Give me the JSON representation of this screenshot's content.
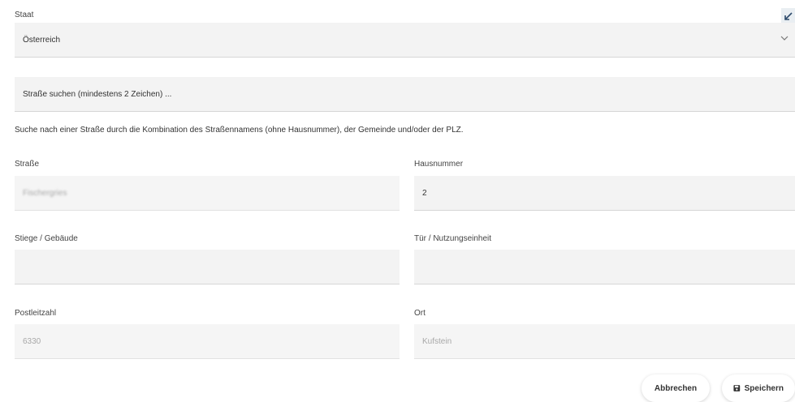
{
  "staat": {
    "label": "Staat",
    "value": "Österreich"
  },
  "search": {
    "placeholder": "Straße suchen (mindestens 2 Zeichen) ..."
  },
  "hint": "Suche nach einer Straße durch die Kombination des Straßennamens (ohne Hausnummer), der Gemeinde und/oder der PLZ.",
  "strasse": {
    "label": "Straße",
    "value": "Fischergries"
  },
  "hausnummer": {
    "label": "Hausnummer",
    "value": "2"
  },
  "stiege": {
    "label": "Stiege / Gebäude",
    "value": ""
  },
  "tuer": {
    "label": "Tür / Nutzungseinheit",
    "value": ""
  },
  "plz": {
    "label": "Postleitzahl",
    "value": "6330"
  },
  "ort": {
    "label": "Ort",
    "value": "Kufstein"
  },
  "buttons": {
    "cancel": "Abbrechen",
    "save": "Speichern"
  },
  "icons": {
    "expand": "expand-arrow-icon",
    "chevron": "chevron-down-icon",
    "save": "floppy-disk-icon"
  }
}
